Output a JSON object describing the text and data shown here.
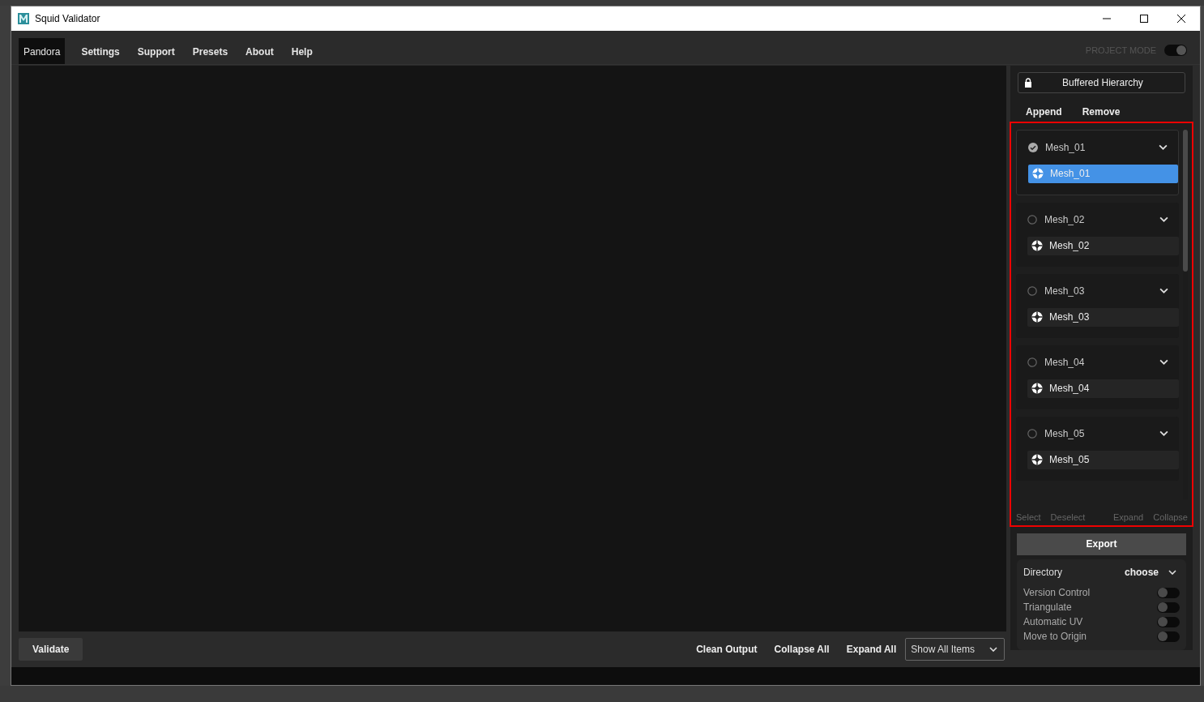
{
  "window": {
    "title": "Squid Validator"
  },
  "menu": [
    {
      "label": "Pandora",
      "selected": true
    },
    {
      "label": "Settings",
      "selected": false
    },
    {
      "label": "Support",
      "selected": false
    },
    {
      "label": "Presets",
      "selected": false
    },
    {
      "label": "About",
      "selected": false
    },
    {
      "label": "Help",
      "selected": false
    }
  ],
  "project_mode": {
    "label": "PROJECT MODE",
    "on": true
  },
  "hierarchy": {
    "label": "Buffered Hierarchy",
    "locked": true
  },
  "hierarchy_actions": [
    "Append",
    "Remove"
  ],
  "meshes": [
    {
      "label": "Mesh_01",
      "checked": true,
      "expanded": true,
      "children": [
        {
          "label": "Mesh_01",
          "selected": true
        }
      ]
    },
    {
      "label": "Mesh_02",
      "checked": false,
      "expanded": true,
      "children": [
        {
          "label": "Mesh_02",
          "selected": false
        }
      ]
    },
    {
      "label": "Mesh_03",
      "checked": false,
      "expanded": true,
      "children": [
        {
          "label": "Mesh_03",
          "selected": false
        }
      ]
    },
    {
      "label": "Mesh_04",
      "checked": false,
      "expanded": true,
      "children": [
        {
          "label": "Mesh_04",
          "selected": false
        }
      ]
    },
    {
      "label": "Mesh_05",
      "checked": false,
      "expanded": true,
      "children": [
        {
          "label": "Mesh_05",
          "selected": false
        }
      ]
    }
  ],
  "list_actions": {
    "left": [
      "Select",
      "Deselect"
    ],
    "right": [
      "Expand",
      "Collapse"
    ]
  },
  "export": {
    "label": "Export",
    "directory_label": "Directory",
    "directory_value": "choose",
    "options": [
      {
        "label": "Version Control",
        "on": false
      },
      {
        "label": "Triangulate",
        "on": false
      },
      {
        "label": "Automatic UV",
        "on": false
      },
      {
        "label": "Move to Origin",
        "on": false
      }
    ]
  },
  "bottom": {
    "validate": "Validate",
    "actions": [
      "Clean Output",
      "Collapse All",
      "Expand All"
    ],
    "filter": "Show All Items"
  }
}
